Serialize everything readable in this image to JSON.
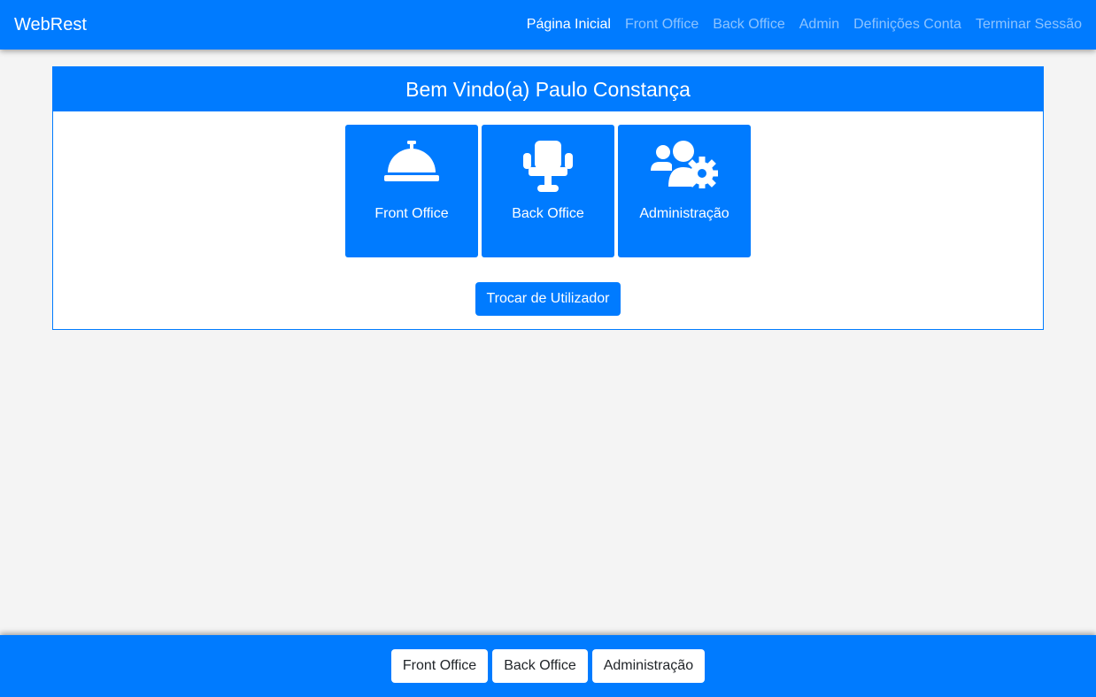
{
  "navbar": {
    "brand": "WebRest",
    "links": [
      {
        "label": "Página Inicial",
        "active": true
      },
      {
        "label": "Front Office",
        "active": false
      },
      {
        "label": "Back Office",
        "active": false
      },
      {
        "label": "Admin",
        "active": false
      },
      {
        "label": "Definições Conta",
        "active": false
      },
      {
        "label": "Terminar Sessão",
        "active": false
      }
    ]
  },
  "main": {
    "welcome": "Bem Vindo(a) Paulo Constança",
    "tiles": [
      {
        "label": "Front Office",
        "icon": "concierge-bell-icon"
      },
      {
        "label": "Back Office",
        "icon": "chair-icon"
      },
      {
        "label": "Administração",
        "icon": "users-cog-icon"
      }
    ],
    "switch_user_label": "Trocar de Utilizador"
  },
  "footer": {
    "buttons": [
      "Front Office",
      "Back Office",
      "Administração"
    ]
  },
  "colors": {
    "primary": "#007bff",
    "background": "#f4f4f4"
  }
}
